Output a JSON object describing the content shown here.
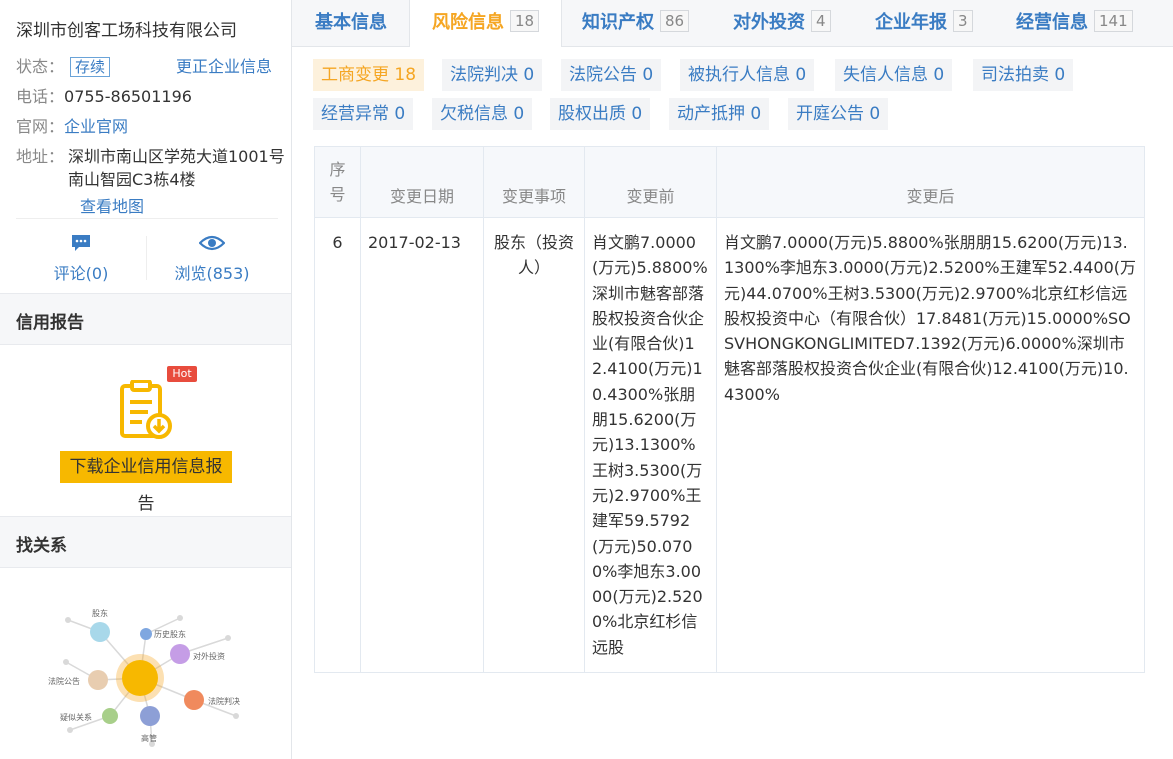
{
  "company": {
    "name": "深圳市创客工场科技有限公司",
    "status_label": "状态：",
    "status": "存续",
    "correct_link": "更正企业信息",
    "phone_label": "电话：",
    "phone": "0755-86501196",
    "website_label": "官网：",
    "website": "企业官网",
    "address_label": "地址：",
    "address": "深圳市南山区学苑大道1001号南山智园C3栋4楼",
    "map_link": "查看地图",
    "comments": "评论(0)",
    "views": "浏览(853)"
  },
  "credit_report": {
    "title": "信用报告",
    "hot": "Hot",
    "download_line1": "下载企业信用信息报",
    "download_line2": "告"
  },
  "relations": {
    "title": "找关系",
    "nodes": [
      "股东",
      "历史股东",
      "对外投资",
      "法院判决",
      "高管",
      "疑似关系",
      "法院公告"
    ]
  },
  "tabs": [
    {
      "label": "基本信息",
      "count": ""
    },
    {
      "label": "风险信息",
      "count": "18"
    },
    {
      "label": "知识产权",
      "count": "86"
    },
    {
      "label": "对外投资",
      "count": "4"
    },
    {
      "label": "企业年报",
      "count": "3"
    },
    {
      "label": "经营信息",
      "count": "141"
    }
  ],
  "filters": [
    "工商变更 18",
    "法院判决 0",
    "法院公告 0",
    "被执行人信息 0",
    "失信人信息 0",
    "司法拍卖 0",
    "经营异常 0",
    "欠税信息 0",
    "股权出质 0",
    "动产抵押 0",
    "开庭公告 0"
  ],
  "table": {
    "headers": [
      "序号",
      "变更日期",
      "变更事项",
      "变更前",
      "变更后"
    ],
    "rows": [
      {
        "seq": "6",
        "date": "2017-02-13",
        "item": "股东（投资人）",
        "before": "肖文鹏7.0000(万元)5.8800%深圳市魅客部落股权投资合伙企业(有限合伙)12.4100(万元)10.4300%张朋朋15.6200(万元)13.1300%王树3.5300(万元)2.9700%王建军59.5792(万元)50.0700%李旭东3.0000(万元)2.5200%北京红杉信远股",
        "after": "肖文鹏7.0000(万元)5.8800%张朋朋15.6200(万元)13.1300%李旭东3.0000(万元)2.5200%王建军52.4400(万元)44.0700%王树3.5300(万元)2.9700%北京红杉信远股权投资中心（有限合伙）17.8481(万元)15.0000%SOSVHONGKONGLIMITED7.1392(万元)6.0000%深圳市魅客部落股权投资合伙企业(有限合伙)12.4100(万元)10.4300%"
      }
    ]
  },
  "colors": {
    "link": "#3a7cc3",
    "accent_orange": "#f5a623",
    "download_button": "#f7b800",
    "hot_badge": "#e84c3d"
  }
}
